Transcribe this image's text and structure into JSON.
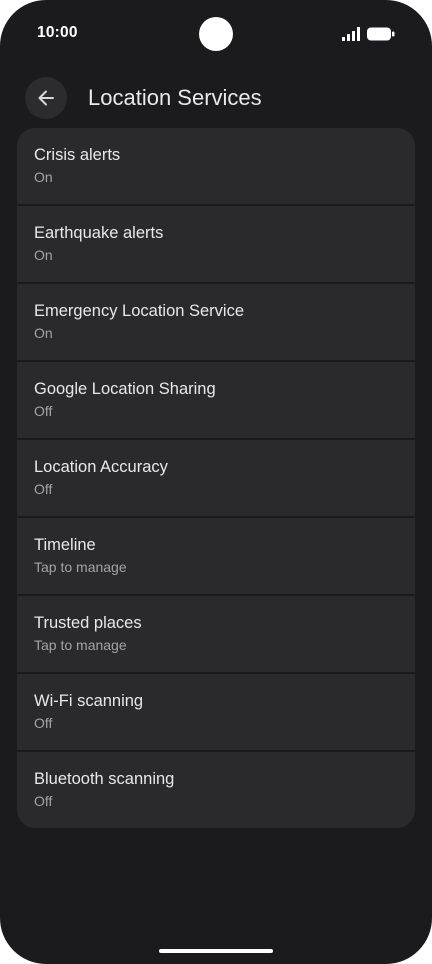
{
  "status_bar": {
    "time": "10:00"
  },
  "header": {
    "title": "Location Services",
    "back_icon": "arrow-back-icon"
  },
  "settings": [
    {
      "title": "Crisis alerts",
      "subtitle": "On"
    },
    {
      "title": "Earthquake alerts",
      "subtitle": "On"
    },
    {
      "title": "Emergency Location Service",
      "subtitle": "On"
    },
    {
      "title": "Google Location Sharing",
      "subtitle": "Off"
    },
    {
      "title": "Location Accuracy",
      "subtitle": "Off"
    },
    {
      "title": "Timeline",
      "subtitle": "Tap to manage"
    },
    {
      "title": "Trusted places",
      "subtitle": "Tap to manage"
    },
    {
      "title": "Wi-Fi scanning",
      "subtitle": "Off"
    },
    {
      "title": "Bluetooth scanning",
      "subtitle": "Off"
    }
  ],
  "colors": {
    "background": "#1b1b1d",
    "card": "#2a2a2c",
    "title_text": "#e8e8ea",
    "subtitle_text": "#a3a3a8"
  }
}
